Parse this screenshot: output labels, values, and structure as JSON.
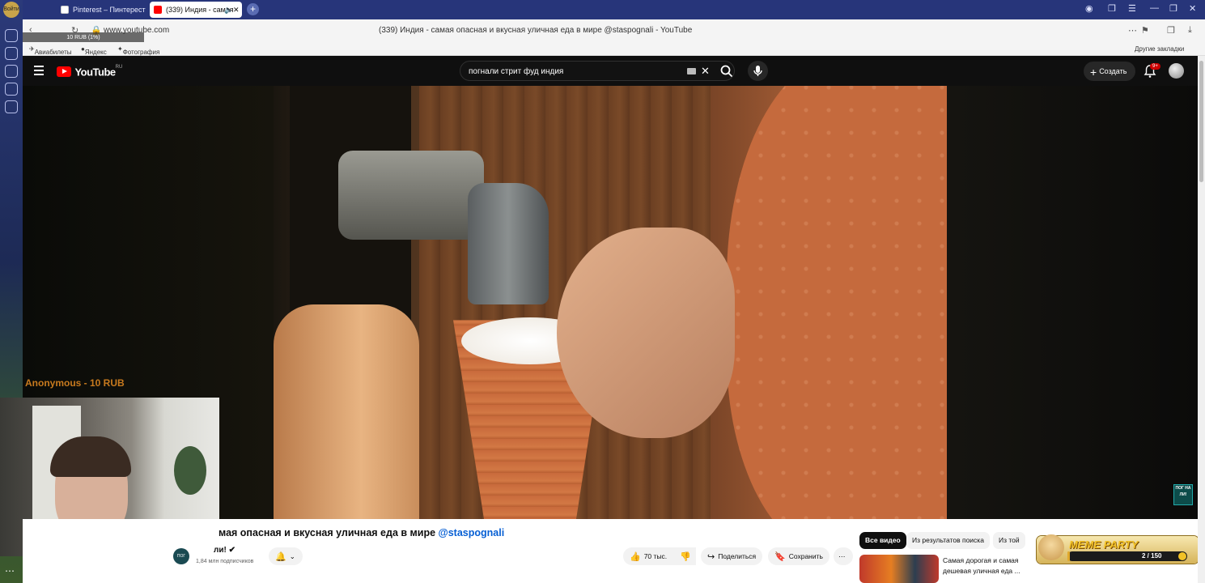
{
  "browser": {
    "tabs": [
      {
        "label": "Pinterest – Пинтерест",
        "active": false
      },
      {
        "label": "(339) Индия - самая",
        "active": true
      }
    ],
    "url": "www.youtube.com",
    "page_title": "(339) Индия - самая опасная и вкусная уличная еда в мире @staspognali - YouTube",
    "bookmarks": [
      "Авиабилеты",
      "Яндекс",
      "Фотография - Go"
    ],
    "other_bookmarks": "Другие закладки",
    "side_badge": "Войти"
  },
  "stream": {
    "donation_banner": "10 RUB (1%)",
    "donor_line": "Anonymous - 10 RUB"
  },
  "youtube": {
    "logo_text": "YouTube",
    "region": "RU",
    "search_value": "погнали стрит фуд индия",
    "create_label": "Создать",
    "notif_badge": "9+",
    "channel_mark": "ПОГ НА ЛИ!"
  },
  "video": {
    "title_visible": "мая опасная и вкусная уличная еда в мире",
    "title_handle": "@staspognali",
    "channel_name_visible": "ли!",
    "subscribers": "1,84 млн подписчиков",
    "likes": "70 тыс.",
    "share_label": "Поделиться",
    "save_label": "Сохранить"
  },
  "related": {
    "chips": [
      "Все видео",
      "Из результатов поиска",
      "Из той"
    ],
    "first_title": "Самая дорогая и самая дешевая уличная еда ..."
  },
  "meme_party": {
    "logo": "MEME PARTY",
    "count": "2 / 150",
    "progress": 0.0133
  },
  "colors": {
    "accent": "#ff0000",
    "link": "#065fd4",
    "donor": "#c87a1e"
  }
}
